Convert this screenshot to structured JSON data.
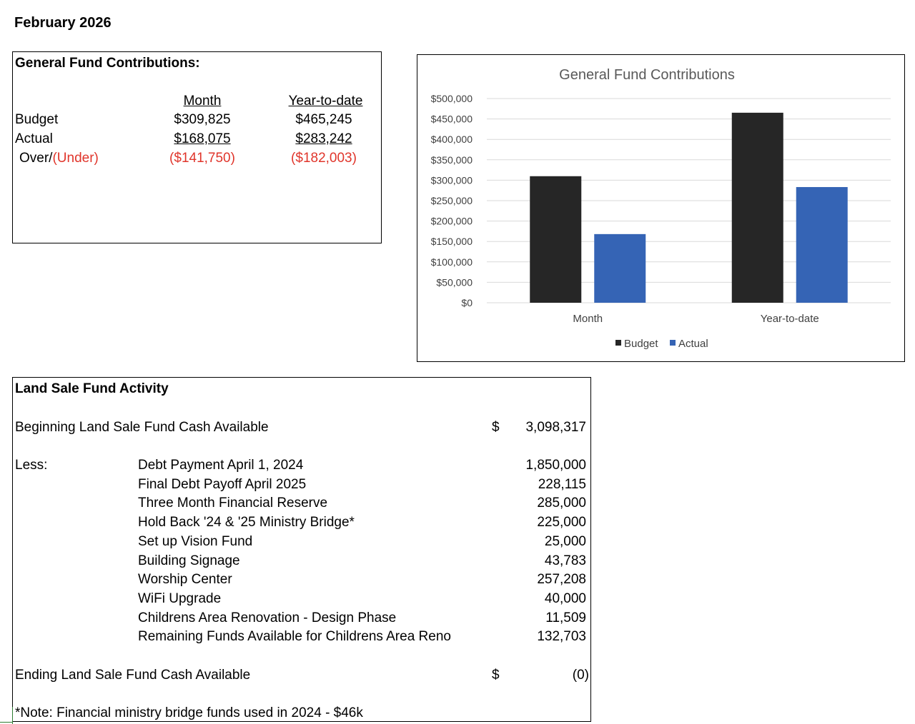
{
  "page_title": "February 2026",
  "general_fund": {
    "title": "General Fund Contributions:",
    "col_month": "Month",
    "col_ytd": "Year-to-date",
    "rows": {
      "budget_label": "Budget",
      "actual_label": "Actual",
      "over_label": "Over/",
      "under_label": "(Under)",
      "budget_month": "$309,825",
      "budget_ytd": "$465,245",
      "actual_month": "$168,075",
      "actual_ytd": "$283,242",
      "diff_month": "($141,750)",
      "diff_ytd": "($182,003)"
    }
  },
  "chart_data": {
    "type": "bar",
    "title": "General Fund Contributions",
    "categories": [
      "Month",
      "Year-to-date"
    ],
    "series": [
      {
        "name": "Budget",
        "values": [
          309825,
          465245
        ],
        "color": "#262626"
      },
      {
        "name": "Actual",
        "values": [
          168075,
          283242
        ],
        "color": "#3564b5"
      }
    ],
    "ylim": [
      0,
      500000
    ],
    "yticks": [
      0,
      50000,
      100000,
      150000,
      200000,
      250000,
      300000,
      350000,
      400000,
      450000,
      500000
    ],
    "ytick_labels": [
      "$0",
      "$50,000",
      "$100,000",
      "$150,000",
      "$200,000",
      "$250,000",
      "$300,000",
      "$350,000",
      "$400,000",
      "$450,000",
      "$500,000"
    ],
    "grid": true,
    "legend": "bottom"
  },
  "land_sale": {
    "title": "Land Sale Fund Activity",
    "beginning_label": "Beginning Land Sale Fund Cash Available",
    "beginning_currency": "$",
    "beginning_value": "3,098,317",
    "less_label": "Less:",
    "items": [
      {
        "label": "Debt Payment April 1, 2024",
        "value": "1,850,000"
      },
      {
        "label": "Final Debt Payoff April 2025",
        "value": "228,115"
      },
      {
        "label": "Three Month Financial Reserve",
        "value": "285,000"
      },
      {
        "label": "Hold Back '24 & '25 Ministry Bridge*",
        "value": "225,000"
      },
      {
        "label": "Set up Vision Fund",
        "value": "25,000"
      },
      {
        "label": "Building Signage",
        "value": "43,783"
      },
      {
        "label": "Worship Center",
        "value": "257,208"
      },
      {
        "label": "WiFi Upgrade",
        "value": "40,000"
      },
      {
        "label": "Childrens Area Renovation - Design Phase",
        "value": "11,509"
      },
      {
        "label": "Remaining Funds Available for Childrens Area Reno",
        "value": "132,703"
      }
    ],
    "ending_label": "Ending Land Sale Fund Cash Available",
    "ending_currency": "$",
    "ending_value": "(0)",
    "note": "*Note:  Financial ministry bridge funds used in 2024 - $46k"
  }
}
